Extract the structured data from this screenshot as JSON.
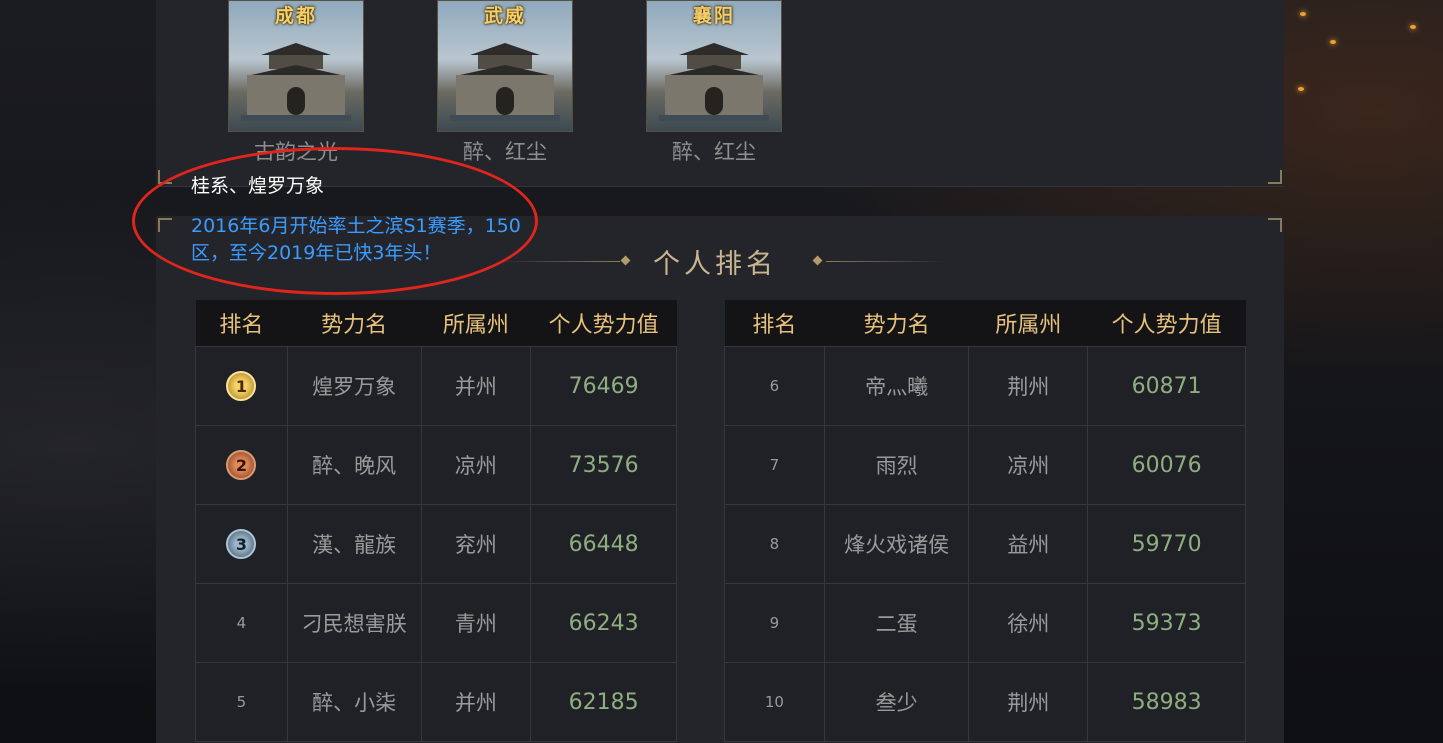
{
  "cities": [
    {
      "name": "成都",
      "owner": "古韵之光"
    },
    {
      "name": "武威",
      "owner": "醉、红尘"
    },
    {
      "name": "襄阳",
      "owner": "醉、红尘"
    }
  ],
  "annotation": {
    "line1": "桂系、煌罗万象",
    "line2": "2016年6月开始率土之滨S1赛季，150区，至今2019年已快3年头！"
  },
  "ranking": {
    "title": "个人排名",
    "headers": [
      "排名",
      "势力名",
      "所属州",
      "个人势力值"
    ],
    "left": [
      {
        "rank": "1",
        "name": "煌罗万象",
        "state": "并州",
        "value": "76469"
      },
      {
        "rank": "2",
        "name": "醉、晚风",
        "state": "凉州",
        "value": "73576"
      },
      {
        "rank": "3",
        "name": "漢、龍族",
        "state": "兖州",
        "value": "66448"
      },
      {
        "rank": "4",
        "name": "刁民想害朕",
        "state": "青州",
        "value": "66243"
      },
      {
        "rank": "5",
        "name": "醉、小柒",
        "state": "并州",
        "value": "62185"
      }
    ],
    "right": [
      {
        "rank": "6",
        "name": "帝灬曦",
        "state": "荆州",
        "value": "60871"
      },
      {
        "rank": "7",
        "name": "雨烈",
        "state": "凉州",
        "value": "60076"
      },
      {
        "rank": "8",
        "name": "烽火戏诸侯",
        "state": "益州",
        "value": "59770"
      },
      {
        "rank": "9",
        "name": "二蛋",
        "state": "徐州",
        "value": "59373"
      },
      {
        "rank": "10",
        "name": "叁少",
        "state": "荆州",
        "value": "58983"
      }
    ]
  }
}
